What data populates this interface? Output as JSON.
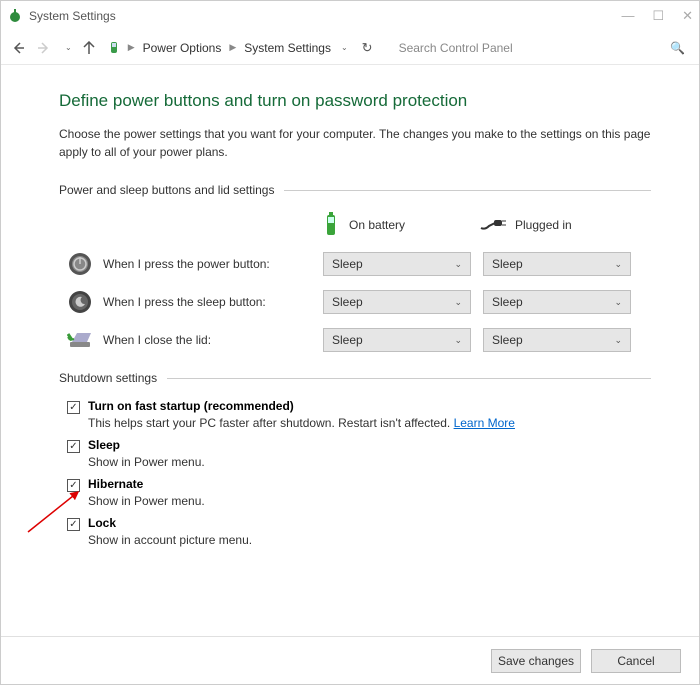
{
  "window": {
    "title": "System Settings"
  },
  "nav": {
    "breadcrumbs": [
      "Power Options",
      "System Settings"
    ],
    "search_placeholder": "Search Control Panel"
  },
  "main": {
    "heading": "Define power buttons and turn on password protection",
    "desc": "Choose the power settings that you want for your computer. The changes you make to the settings on this page apply to all of your power plans.",
    "section1_title": "Power and sleep buttons and lid settings",
    "col_battery": "On battery",
    "col_plugged": "Plugged in",
    "row_power": "When I press the power button:",
    "row_sleep": "When I press the sleep button:",
    "row_lid": "When I close the lid:",
    "sel_value": "Sleep",
    "section2_title": "Shutdown settings",
    "fast_label": "Turn on fast startup (recommended)",
    "fast_desc_a": "This helps start your PC faster after shutdown. Restart isn't affected. ",
    "fast_learn": "Learn More",
    "sleep_label": "Sleep",
    "sleep_desc": "Show in Power menu.",
    "hib_label": "Hibernate",
    "hib_desc": "Show in Power menu.",
    "lock_label": "Lock",
    "lock_desc": "Show in account picture menu."
  },
  "footer": {
    "save": "Save changes",
    "cancel": "Cancel"
  }
}
